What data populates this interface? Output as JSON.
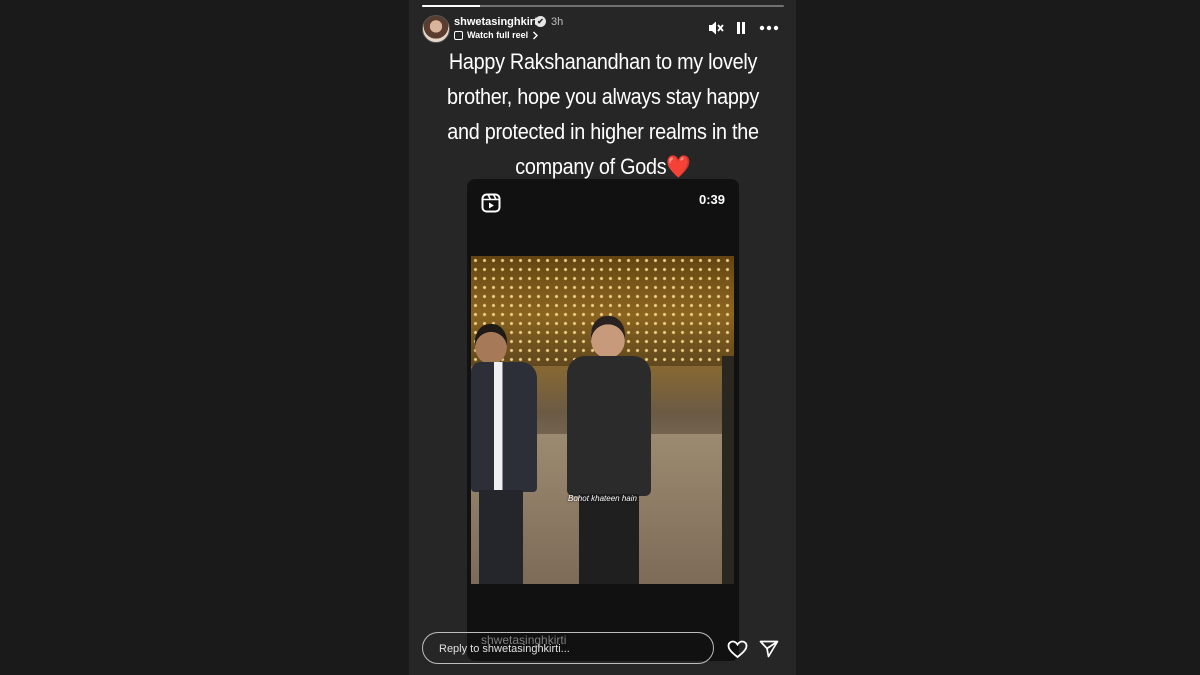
{
  "story": {
    "progress": 0.16,
    "username": "shwetasinghkirti",
    "verified_mark": "✔",
    "time_ago": "3h",
    "watch_full_reel": "Watch full reel",
    "caption_lines": [
      "Happy Rakshanandhan to my lovely",
      "brother, hope you always stay happy",
      "and protected in higher realms in the",
      "company of Gods❤️"
    ]
  },
  "controls": {
    "mute_icon": "speaker-muted-icon",
    "pause_icon": "pause-icon",
    "more_icon": "more-options-icon"
  },
  "reel": {
    "duration": "0:39",
    "subtitle": "Bohot khateen hain"
  },
  "footer": {
    "reply_placeholder": "Reply to shwetasinghkirti...",
    "watermark": "shwetasinghkirti",
    "like_icon": "heart-icon",
    "share_icon": "send-icon"
  },
  "colors": {
    "background": "#1a1a1a",
    "story_panel": "#262626",
    "text": "#ffffff"
  }
}
